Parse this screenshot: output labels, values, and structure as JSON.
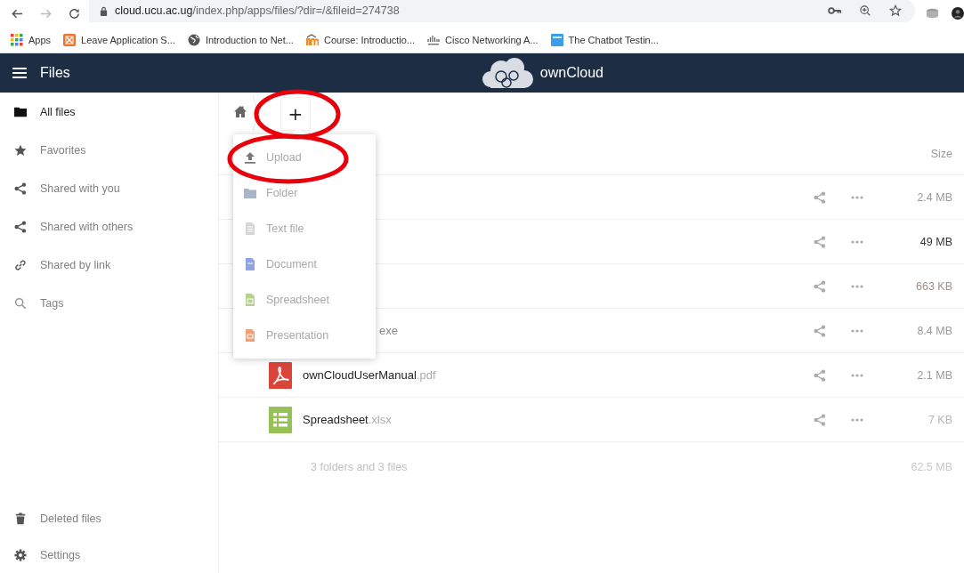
{
  "browser": {
    "url": {
      "host": "cloud.ucu.ac.ug",
      "path": "/index.php/apps/files/?dir=/&fileid=274738"
    },
    "bookmarks": [
      {
        "label": "Apps",
        "kind": "apps"
      },
      {
        "label": "Leave Application S...",
        "kind": "leave"
      },
      {
        "label": "Introduction to Net...",
        "kind": "globe"
      },
      {
        "label": "Course: Introductio...",
        "kind": "course"
      },
      {
        "label": "Cisco Networking A...",
        "kind": "cisco"
      },
      {
        "label": "The Chatbot Testin...",
        "kind": "chatbot"
      }
    ]
  },
  "app_header": {
    "title": "Files",
    "brand": "ownCloud"
  },
  "sidebar": {
    "items": [
      {
        "label": "All files",
        "kind": "folder",
        "selected": true
      },
      {
        "label": "Favorites",
        "kind": "star",
        "selected": false
      },
      {
        "label": "Shared with you",
        "kind": "share",
        "selected": false
      },
      {
        "label": "Shared with others",
        "kind": "share",
        "selected": false
      },
      {
        "label": "Shared by link",
        "kind": "link",
        "selected": false
      },
      {
        "label": "Tags",
        "kind": "search",
        "selected": false
      }
    ],
    "bottom_items": [
      {
        "label": "Deleted files",
        "kind": "trash"
      },
      {
        "label": "Settings",
        "kind": "gear"
      }
    ]
  },
  "breadcrumb": {
    "new_button": {
      "label": "+",
      "highlighted": true
    }
  },
  "new_menu": {
    "items": [
      {
        "label": "Upload",
        "kind": "upload",
        "highlighted": true
      },
      {
        "label": "Folder",
        "kind": "folder",
        "highlighted": false
      },
      {
        "label": "Text file",
        "kind": "text",
        "highlighted": false
      },
      {
        "label": "Document",
        "kind": "document",
        "highlighted": false
      },
      {
        "label": "Spreadsheet",
        "kind": "spreadsheet",
        "highlighted": false
      },
      {
        "label": "Presentation",
        "kind": "presentation",
        "highlighted": false
      }
    ]
  },
  "file_list": {
    "columns": [
      {
        "label": "Size"
      }
    ],
    "rows": [
      {
        "size": "2.4 MB",
        "color": "#9a9a9a"
      },
      {
        "size": "49 MB",
        "color": "#333333"
      },
      {
        "size": "663 KB",
        "color": "#a08f82"
      },
      {
        "ext": "exe",
        "size": "8.4 MB",
        "color": "#9a9a9a"
      },
      {
        "kind": "pdf",
        "name": "ownCloudUserManual",
        "ext": ".pdf",
        "size": "2.1 MB",
        "color": "#9a9a9a"
      },
      {
        "kind": "spreadsheet",
        "name": "Spreadsheet",
        "ext": ".xlsx",
        "size": "7 KB",
        "color": "#b5b5b5"
      }
    ],
    "summary": {
      "label": "3 folders and 3 files",
      "size": "62.5 MB"
    }
  }
}
